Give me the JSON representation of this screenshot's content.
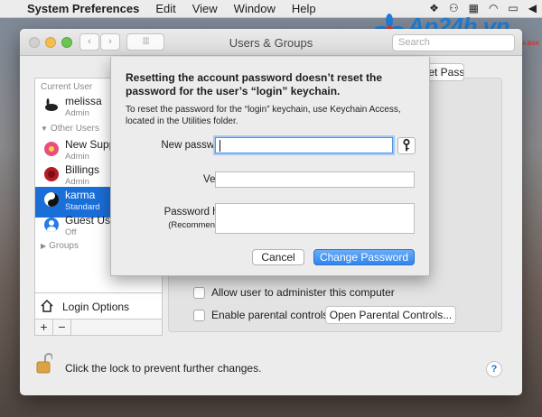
{
  "menubar": {
    "app_name": "System Preferences",
    "menus": [
      "Edit",
      "View",
      "Window",
      "Help"
    ],
    "status_icons": [
      "dropbox-icon",
      "people-icon",
      "grid-icon",
      "wifi-icon",
      "airplay-icon",
      "volume-icon"
    ]
  },
  "watermark": {
    "brand": "Ap24h.vn",
    "tagline": "CHUYÊN GIA MACBOOK CỦA BẠN"
  },
  "window": {
    "title": "Users & Groups",
    "search_placeholder": "Search"
  },
  "sidebar": {
    "current_user_header": "Current User",
    "other_users_header": "Other Users",
    "groups_label": "Groups",
    "current_user": {
      "name": "melissa",
      "role": "Admin"
    },
    "other_users": [
      {
        "name": "New Support",
        "role": "Admin"
      },
      {
        "name": "Billings",
        "role": "Admin"
      },
      {
        "name": "karma",
        "role": "Standard",
        "selected": true
      },
      {
        "name": "Guest User",
        "role": "Off"
      }
    ],
    "login_options": "Login Options",
    "add_label": "+",
    "remove_label": "−"
  },
  "panel": {
    "reset_password_button": "Reset Password...",
    "allow_admin_label": "Allow user to administer this computer",
    "parental_controls_label": "Enable parental controls",
    "open_parental_button": "Open Parental Controls...",
    "lock_text": "Click the lock to prevent further changes.",
    "help_label": "?"
  },
  "sheet": {
    "title": "Resetting the account password doesn’t reset the password for the user’s “login” keychain.",
    "info": "To reset the password for the “login” keychain, use Keychain Access, located in the Utilities folder.",
    "new_password_label": "New password:",
    "new_password_value": "",
    "verify_label": "Verify:",
    "verify_value": "",
    "hint_label": "Password hint:",
    "hint_sub": "(Recommended)",
    "hint_value": "",
    "cancel_button": "Cancel",
    "change_button": "Change Password"
  },
  "colors": {
    "accent": "#1a6ed8",
    "selected_row": "#1a6ed8",
    "primary_button": "#2f86ef",
    "traffic_min": "#f4bd4f",
    "traffic_max": "#6cc551"
  }
}
